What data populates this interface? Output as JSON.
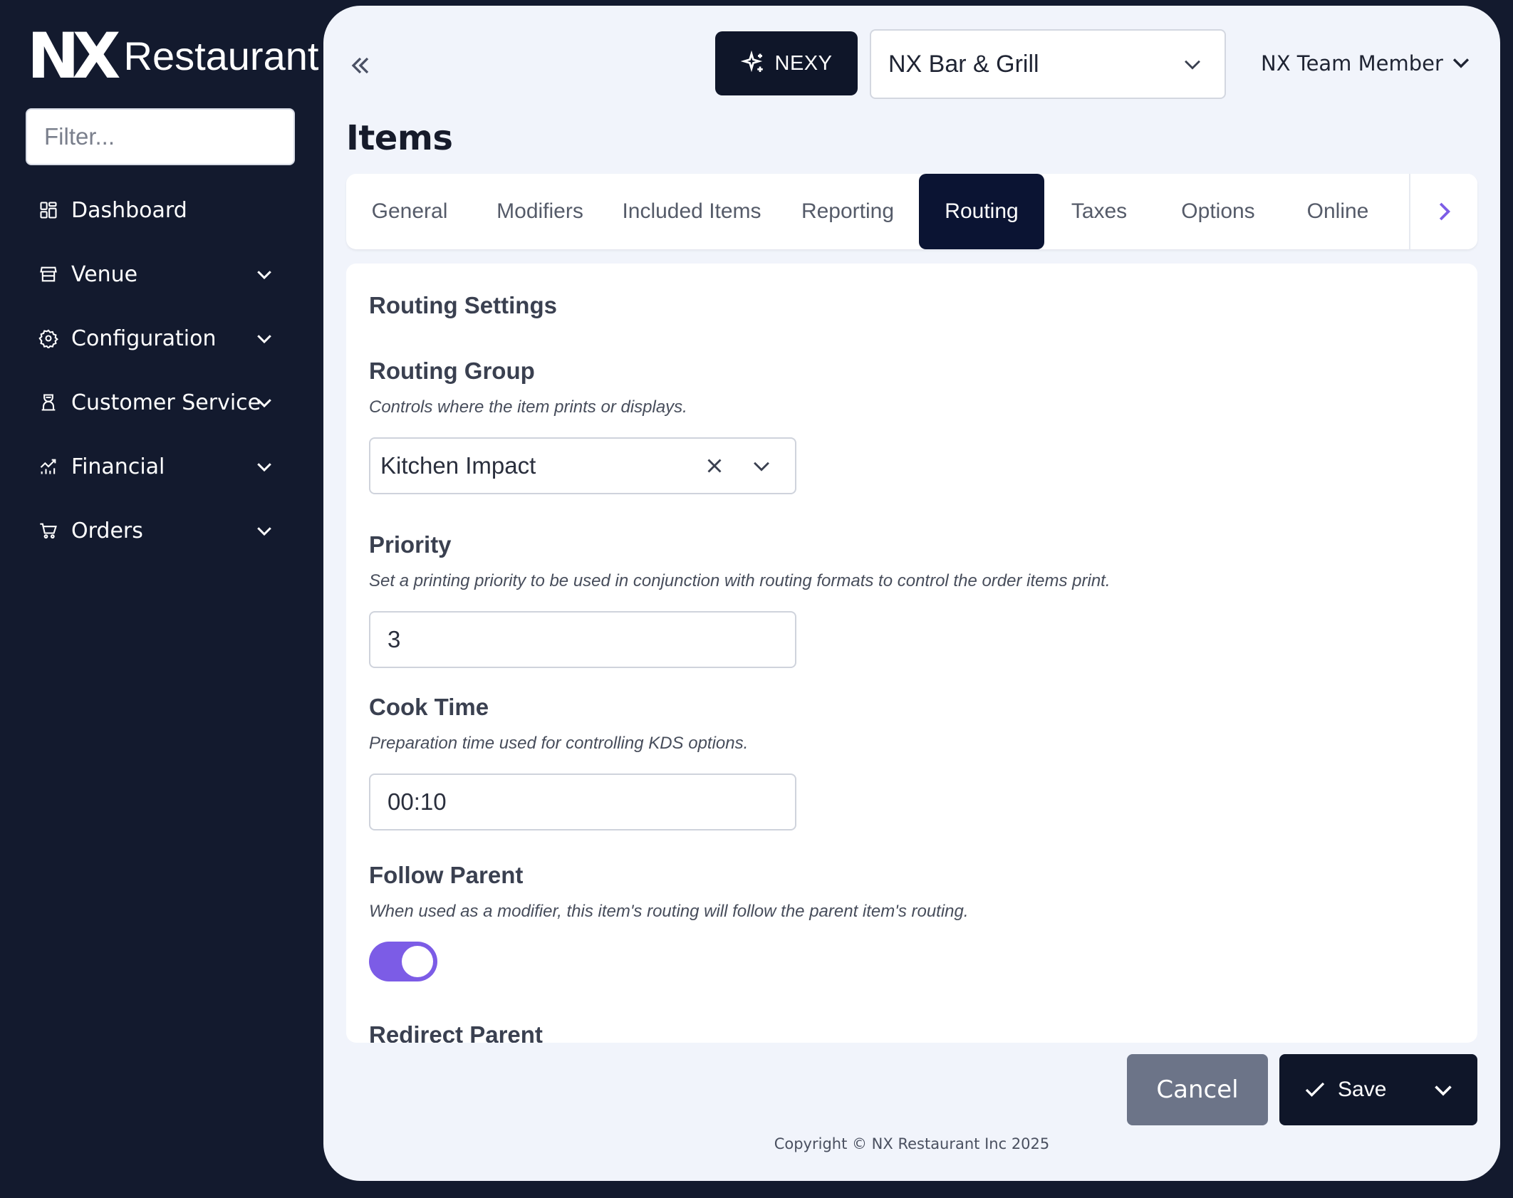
{
  "brand": {
    "mark": "NX",
    "word": "Restaurant"
  },
  "sidebar": {
    "filter_placeholder": "Filter...",
    "items": [
      {
        "label": "Dashboard",
        "icon": "dashboard-icon",
        "expandable": false
      },
      {
        "label": "Venue",
        "icon": "venue-icon",
        "expandable": true
      },
      {
        "label": "Configuration",
        "icon": "gear-icon",
        "expandable": true
      },
      {
        "label": "Customer Service",
        "icon": "customer-service-icon",
        "expandable": true
      },
      {
        "label": "Financial",
        "icon": "chart-icon",
        "expandable": true
      },
      {
        "label": "Orders",
        "icon": "cart-icon",
        "expandable": true
      }
    ]
  },
  "header": {
    "nexy_label": "NEXY",
    "venue": "NX Bar & Grill",
    "user": "NX Team Member"
  },
  "page": {
    "title": "Items"
  },
  "tabs": [
    {
      "label": "General",
      "active": false
    },
    {
      "label": "Modifiers",
      "active": false
    },
    {
      "label": "Included Items",
      "active": false
    },
    {
      "label": "Reporting",
      "active": false
    },
    {
      "label": "Routing",
      "active": true
    },
    {
      "label": "Taxes",
      "active": false
    },
    {
      "label": "Options",
      "active": false
    },
    {
      "label": "Online",
      "active": false
    }
  ],
  "routing": {
    "section_title": "Routing Settings",
    "routing_group": {
      "label": "Routing Group",
      "description": "Controls where the item prints or displays.",
      "value": "Kitchen Impact"
    },
    "priority": {
      "label": "Priority",
      "description": "Set a printing priority to be used in conjunction with routing formats to control the order items print.",
      "value": "3"
    },
    "cook_time": {
      "label": "Cook Time",
      "description": "Preparation time used for controlling KDS options.",
      "value": "00:10"
    },
    "follow_parent": {
      "label": "Follow Parent",
      "description": "When used as a modifier, this item's routing will follow the parent item's routing.",
      "enabled": true
    },
    "redirect_parent": {
      "label": "Redirect Parent"
    }
  },
  "actions": {
    "cancel": "Cancel",
    "save": "Save"
  },
  "footer": {
    "copyright": "Copyright © NX Restaurant Inc 2025"
  },
  "colors": {
    "sidebar_bg": "#131a2e",
    "panel_bg": "#f1f4fb",
    "accent": "#7c5ce6",
    "active_tab": "#0b1433",
    "cancel_bg": "#6c7488"
  }
}
